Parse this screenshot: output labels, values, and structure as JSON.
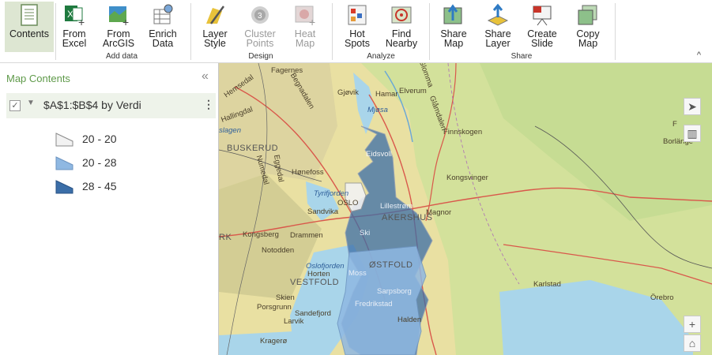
{
  "ribbon": {
    "buttons": {
      "contents": "Contents",
      "from_excel": "From\nExcel",
      "from_arcgis": "From\nArcGIS",
      "enrich_data": "Enrich\nData",
      "layer_style": "Layer\nStyle",
      "cluster_points": "Cluster\nPoints",
      "heat_map": "Heat\nMap",
      "hot_spots": "Hot\nSpots",
      "find_nearby": "Find\nNearby",
      "share_map": "Share\nMap",
      "share_layer": "Share\nLayer",
      "create_slide": "Create\nSlide",
      "copy_map": "Copy\nMap"
    },
    "groups": {
      "add_data": "Add data",
      "design": "Design",
      "analyze": "Analyze",
      "share": "Share"
    },
    "collapse_glyph": "^"
  },
  "panel": {
    "title": "Map Contents",
    "collapse_glyph": "«",
    "layer": {
      "checkbox_glyph": "✓",
      "expand_glyph": "▼",
      "name": "$A$1:$B$4 by Verdi",
      "menu_glyph": "⋮"
    },
    "legend": [
      {
        "label": "20 - 20",
        "color": "#f2f2f2"
      },
      {
        "label": "20 - 28",
        "color": "#8fb8e2"
      },
      {
        "label": "28 - 45",
        "color": "#3b6ea8"
      }
    ]
  },
  "map": {
    "places": {
      "fagernes": "Fagernes",
      "gjovik": "Gjøvik",
      "hamar": "Hamar",
      "elverum": "Elverum",
      "mjosa": "Mjøsa",
      "glomma": "Glomma",
      "glamdalen": "Glåmdalen",
      "hemsedal": "Hemsedal",
      "begnadalen": "Begnadalen",
      "finnskogen": "Finnskogen",
      "hallingdal": "Hallingdal",
      "slagen": "slagen",
      "buskerud": "BUSKERUD",
      "eidsvoll": "Eidsvoll",
      "numedal": "Numedal",
      "eggedal": "Eggedal",
      "honefoss": "Hønefoss",
      "kongsvinger": "Kongsvinger",
      "tyrifjorden": "Tyrifjorden",
      "sandvika": "Sandvika",
      "lillestrom": "Lillestrøm",
      "akershus": "AKERSHUS",
      "magnor": "Magnor",
      "oslo": "OSLO",
      "ski": "Ski",
      "kongsberg": "Kongsberg",
      "drammen": "Drammen",
      "rk": "RK",
      "notodden": "Notodden",
      "ostfold": "ØSTFOLD",
      "oslofjorden": "Oslofjorden",
      "horten": "Horten",
      "moss": "Moss",
      "vestfold": "VESTFOLD",
      "sarpsborg": "Sarpsborg",
      "fredrikstad": "Fredrikstad",
      "karlstad": "Karlstad",
      "orebro": "Örebro",
      "skien": "Skien",
      "porsgrunn": "Porsgrunn",
      "sandefjord": "Sandefjord",
      "larvik": "Larvik",
      "halden": "Halden",
      "kragero": "Kragerø",
      "bollnas": "F",
      "borlange": "Borlänge",
      "vanern": ""
    },
    "controls": {
      "select_glyph": "➤",
      "basemap_glyph": "▥",
      "zoom_in_glyph": "+",
      "home_glyph": "⌂"
    }
  }
}
